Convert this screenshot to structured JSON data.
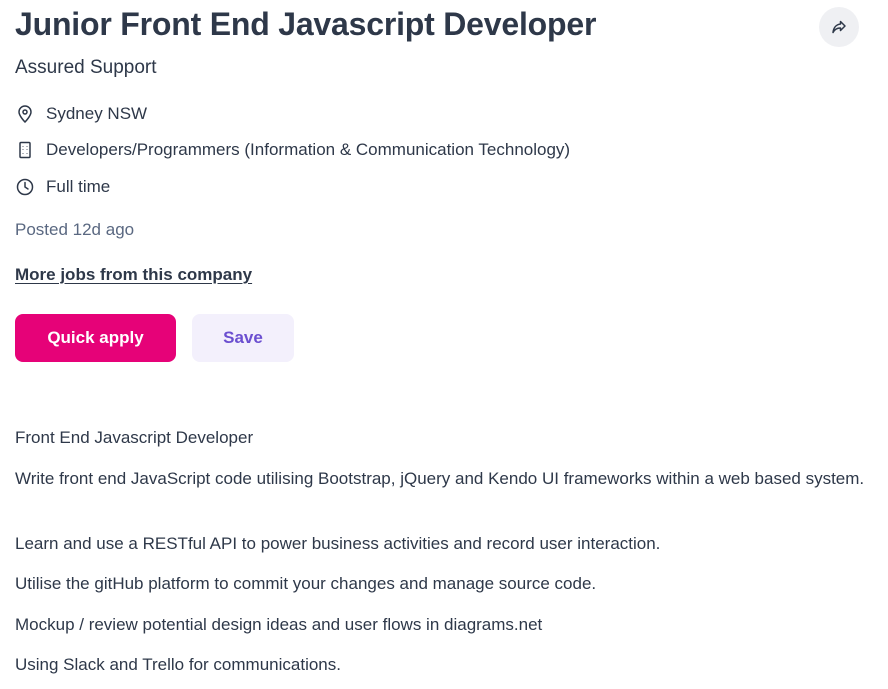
{
  "job": {
    "title": "Junior Front End Javascript Developer",
    "company": "Assured Support",
    "location": "Sydney NSW",
    "classification": "Developers/Programmers (Information & Communication Technology)",
    "work_type": "Full time",
    "posted": "Posted 12d ago",
    "more_jobs_link": "More jobs from this company"
  },
  "actions": {
    "quick_apply_label": "Quick apply",
    "save_label": "Save"
  },
  "icons": {
    "share": "share-icon",
    "location": "location-pin-icon",
    "classification": "building-icon",
    "work_type": "clock-icon"
  },
  "colors": {
    "primary_text": "#2e3849",
    "secondary_text": "#5a6881",
    "apply_button": "#e60278",
    "save_button_bg": "#f3f0fc",
    "save_button_text": "#6b4fd0"
  },
  "description": {
    "paragraphs": [
      "Front End Javascript Developer",
      "Write front end JavaScript code utilising Bootstrap, jQuery and Kendo UI frameworks within a web based system.",
      "Learn and use a RESTful API to power business activities and record user interaction.",
      "Utilise the gitHub platform to commit your changes and manage source code.",
      "Mockup / review potential design ideas and user flows in diagrams.net",
      "Using Slack and Trello for communications."
    ]
  }
}
